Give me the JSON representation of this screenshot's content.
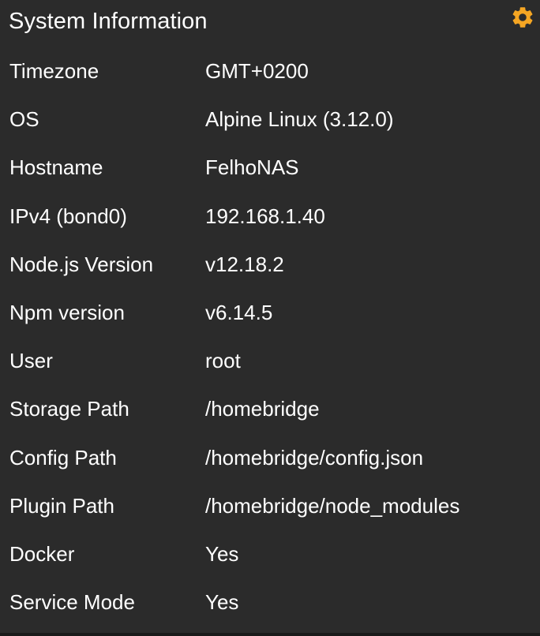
{
  "widget": {
    "title": "System Information",
    "settings_icon": "gear-icon",
    "accent_color": "#f5a623",
    "rows": [
      {
        "label": "Timezone",
        "value": "GMT+0200"
      },
      {
        "label": "OS",
        "value": "Alpine Linux (3.12.0)"
      },
      {
        "label": "Hostname",
        "value": "FelhoNAS"
      },
      {
        "label": "IPv4 (bond0)",
        "value": "192.168.1.40"
      },
      {
        "label": "Node.js Version",
        "value": "v12.18.2"
      },
      {
        "label": "Npm version",
        "value": "v6.14.5"
      },
      {
        "label": "User",
        "value": "root"
      },
      {
        "label": "Storage Path",
        "value": "/homebridge"
      },
      {
        "label": "Config Path",
        "value": "/homebridge/config.json"
      },
      {
        "label": "Plugin Path",
        "value": "/homebridge/node_modules"
      },
      {
        "label": "Docker",
        "value": "Yes"
      },
      {
        "label": "Service Mode",
        "value": "Yes"
      }
    ]
  }
}
